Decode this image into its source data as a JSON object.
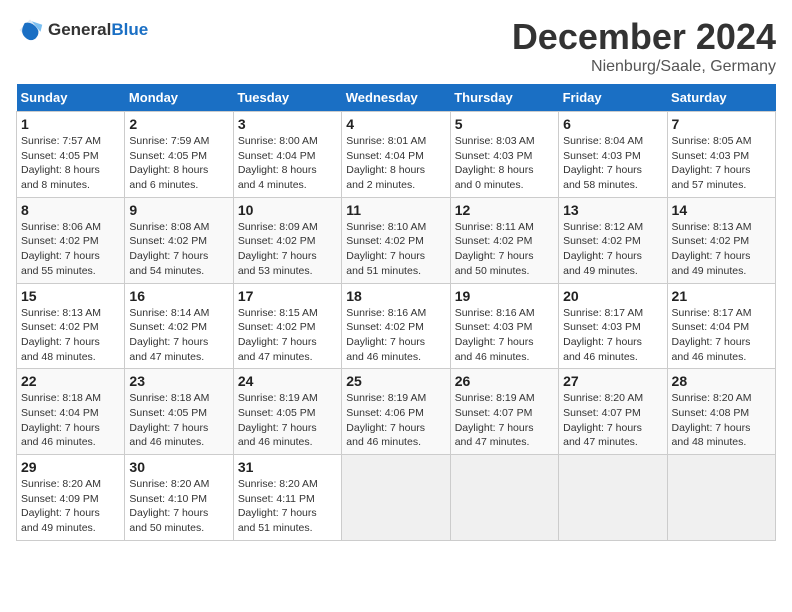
{
  "header": {
    "logo_line1": "General",
    "logo_line2": "Blue",
    "month": "December 2024",
    "location": "Nienburg/Saale, Germany"
  },
  "days_of_week": [
    "Sunday",
    "Monday",
    "Tuesday",
    "Wednesday",
    "Thursday",
    "Friday",
    "Saturday"
  ],
  "weeks": [
    [
      {
        "day": 1,
        "info": "Sunrise: 7:57 AM\nSunset: 4:05 PM\nDaylight: 8 hours\nand 8 minutes."
      },
      {
        "day": 2,
        "info": "Sunrise: 7:59 AM\nSunset: 4:05 PM\nDaylight: 8 hours\nand 6 minutes."
      },
      {
        "day": 3,
        "info": "Sunrise: 8:00 AM\nSunset: 4:04 PM\nDaylight: 8 hours\nand 4 minutes."
      },
      {
        "day": 4,
        "info": "Sunrise: 8:01 AM\nSunset: 4:04 PM\nDaylight: 8 hours\nand 2 minutes."
      },
      {
        "day": 5,
        "info": "Sunrise: 8:03 AM\nSunset: 4:03 PM\nDaylight: 8 hours\nand 0 minutes."
      },
      {
        "day": 6,
        "info": "Sunrise: 8:04 AM\nSunset: 4:03 PM\nDaylight: 7 hours\nand 58 minutes."
      },
      {
        "day": 7,
        "info": "Sunrise: 8:05 AM\nSunset: 4:03 PM\nDaylight: 7 hours\nand 57 minutes."
      }
    ],
    [
      {
        "day": 8,
        "info": "Sunrise: 8:06 AM\nSunset: 4:02 PM\nDaylight: 7 hours\nand 55 minutes."
      },
      {
        "day": 9,
        "info": "Sunrise: 8:08 AM\nSunset: 4:02 PM\nDaylight: 7 hours\nand 54 minutes."
      },
      {
        "day": 10,
        "info": "Sunrise: 8:09 AM\nSunset: 4:02 PM\nDaylight: 7 hours\nand 53 minutes."
      },
      {
        "day": 11,
        "info": "Sunrise: 8:10 AM\nSunset: 4:02 PM\nDaylight: 7 hours\nand 51 minutes."
      },
      {
        "day": 12,
        "info": "Sunrise: 8:11 AM\nSunset: 4:02 PM\nDaylight: 7 hours\nand 50 minutes."
      },
      {
        "day": 13,
        "info": "Sunrise: 8:12 AM\nSunset: 4:02 PM\nDaylight: 7 hours\nand 49 minutes."
      },
      {
        "day": 14,
        "info": "Sunrise: 8:13 AM\nSunset: 4:02 PM\nDaylight: 7 hours\nand 49 minutes."
      }
    ],
    [
      {
        "day": 15,
        "info": "Sunrise: 8:13 AM\nSunset: 4:02 PM\nDaylight: 7 hours\nand 48 minutes."
      },
      {
        "day": 16,
        "info": "Sunrise: 8:14 AM\nSunset: 4:02 PM\nDaylight: 7 hours\nand 47 minutes."
      },
      {
        "day": 17,
        "info": "Sunrise: 8:15 AM\nSunset: 4:02 PM\nDaylight: 7 hours\nand 47 minutes."
      },
      {
        "day": 18,
        "info": "Sunrise: 8:16 AM\nSunset: 4:02 PM\nDaylight: 7 hours\nand 46 minutes."
      },
      {
        "day": 19,
        "info": "Sunrise: 8:16 AM\nSunset: 4:03 PM\nDaylight: 7 hours\nand 46 minutes."
      },
      {
        "day": 20,
        "info": "Sunrise: 8:17 AM\nSunset: 4:03 PM\nDaylight: 7 hours\nand 46 minutes."
      },
      {
        "day": 21,
        "info": "Sunrise: 8:17 AM\nSunset: 4:04 PM\nDaylight: 7 hours\nand 46 minutes."
      }
    ],
    [
      {
        "day": 22,
        "info": "Sunrise: 8:18 AM\nSunset: 4:04 PM\nDaylight: 7 hours\nand 46 minutes."
      },
      {
        "day": 23,
        "info": "Sunrise: 8:18 AM\nSunset: 4:05 PM\nDaylight: 7 hours\nand 46 minutes."
      },
      {
        "day": 24,
        "info": "Sunrise: 8:19 AM\nSunset: 4:05 PM\nDaylight: 7 hours\nand 46 minutes."
      },
      {
        "day": 25,
        "info": "Sunrise: 8:19 AM\nSunset: 4:06 PM\nDaylight: 7 hours\nand 46 minutes."
      },
      {
        "day": 26,
        "info": "Sunrise: 8:19 AM\nSunset: 4:07 PM\nDaylight: 7 hours\nand 47 minutes."
      },
      {
        "day": 27,
        "info": "Sunrise: 8:20 AM\nSunset: 4:07 PM\nDaylight: 7 hours\nand 47 minutes."
      },
      {
        "day": 28,
        "info": "Sunrise: 8:20 AM\nSunset: 4:08 PM\nDaylight: 7 hours\nand 48 minutes."
      }
    ],
    [
      {
        "day": 29,
        "info": "Sunrise: 8:20 AM\nSunset: 4:09 PM\nDaylight: 7 hours\nand 49 minutes."
      },
      {
        "day": 30,
        "info": "Sunrise: 8:20 AM\nSunset: 4:10 PM\nDaylight: 7 hours\nand 50 minutes."
      },
      {
        "day": 31,
        "info": "Sunrise: 8:20 AM\nSunset: 4:11 PM\nDaylight: 7 hours\nand 51 minutes."
      },
      null,
      null,
      null,
      null
    ]
  ]
}
